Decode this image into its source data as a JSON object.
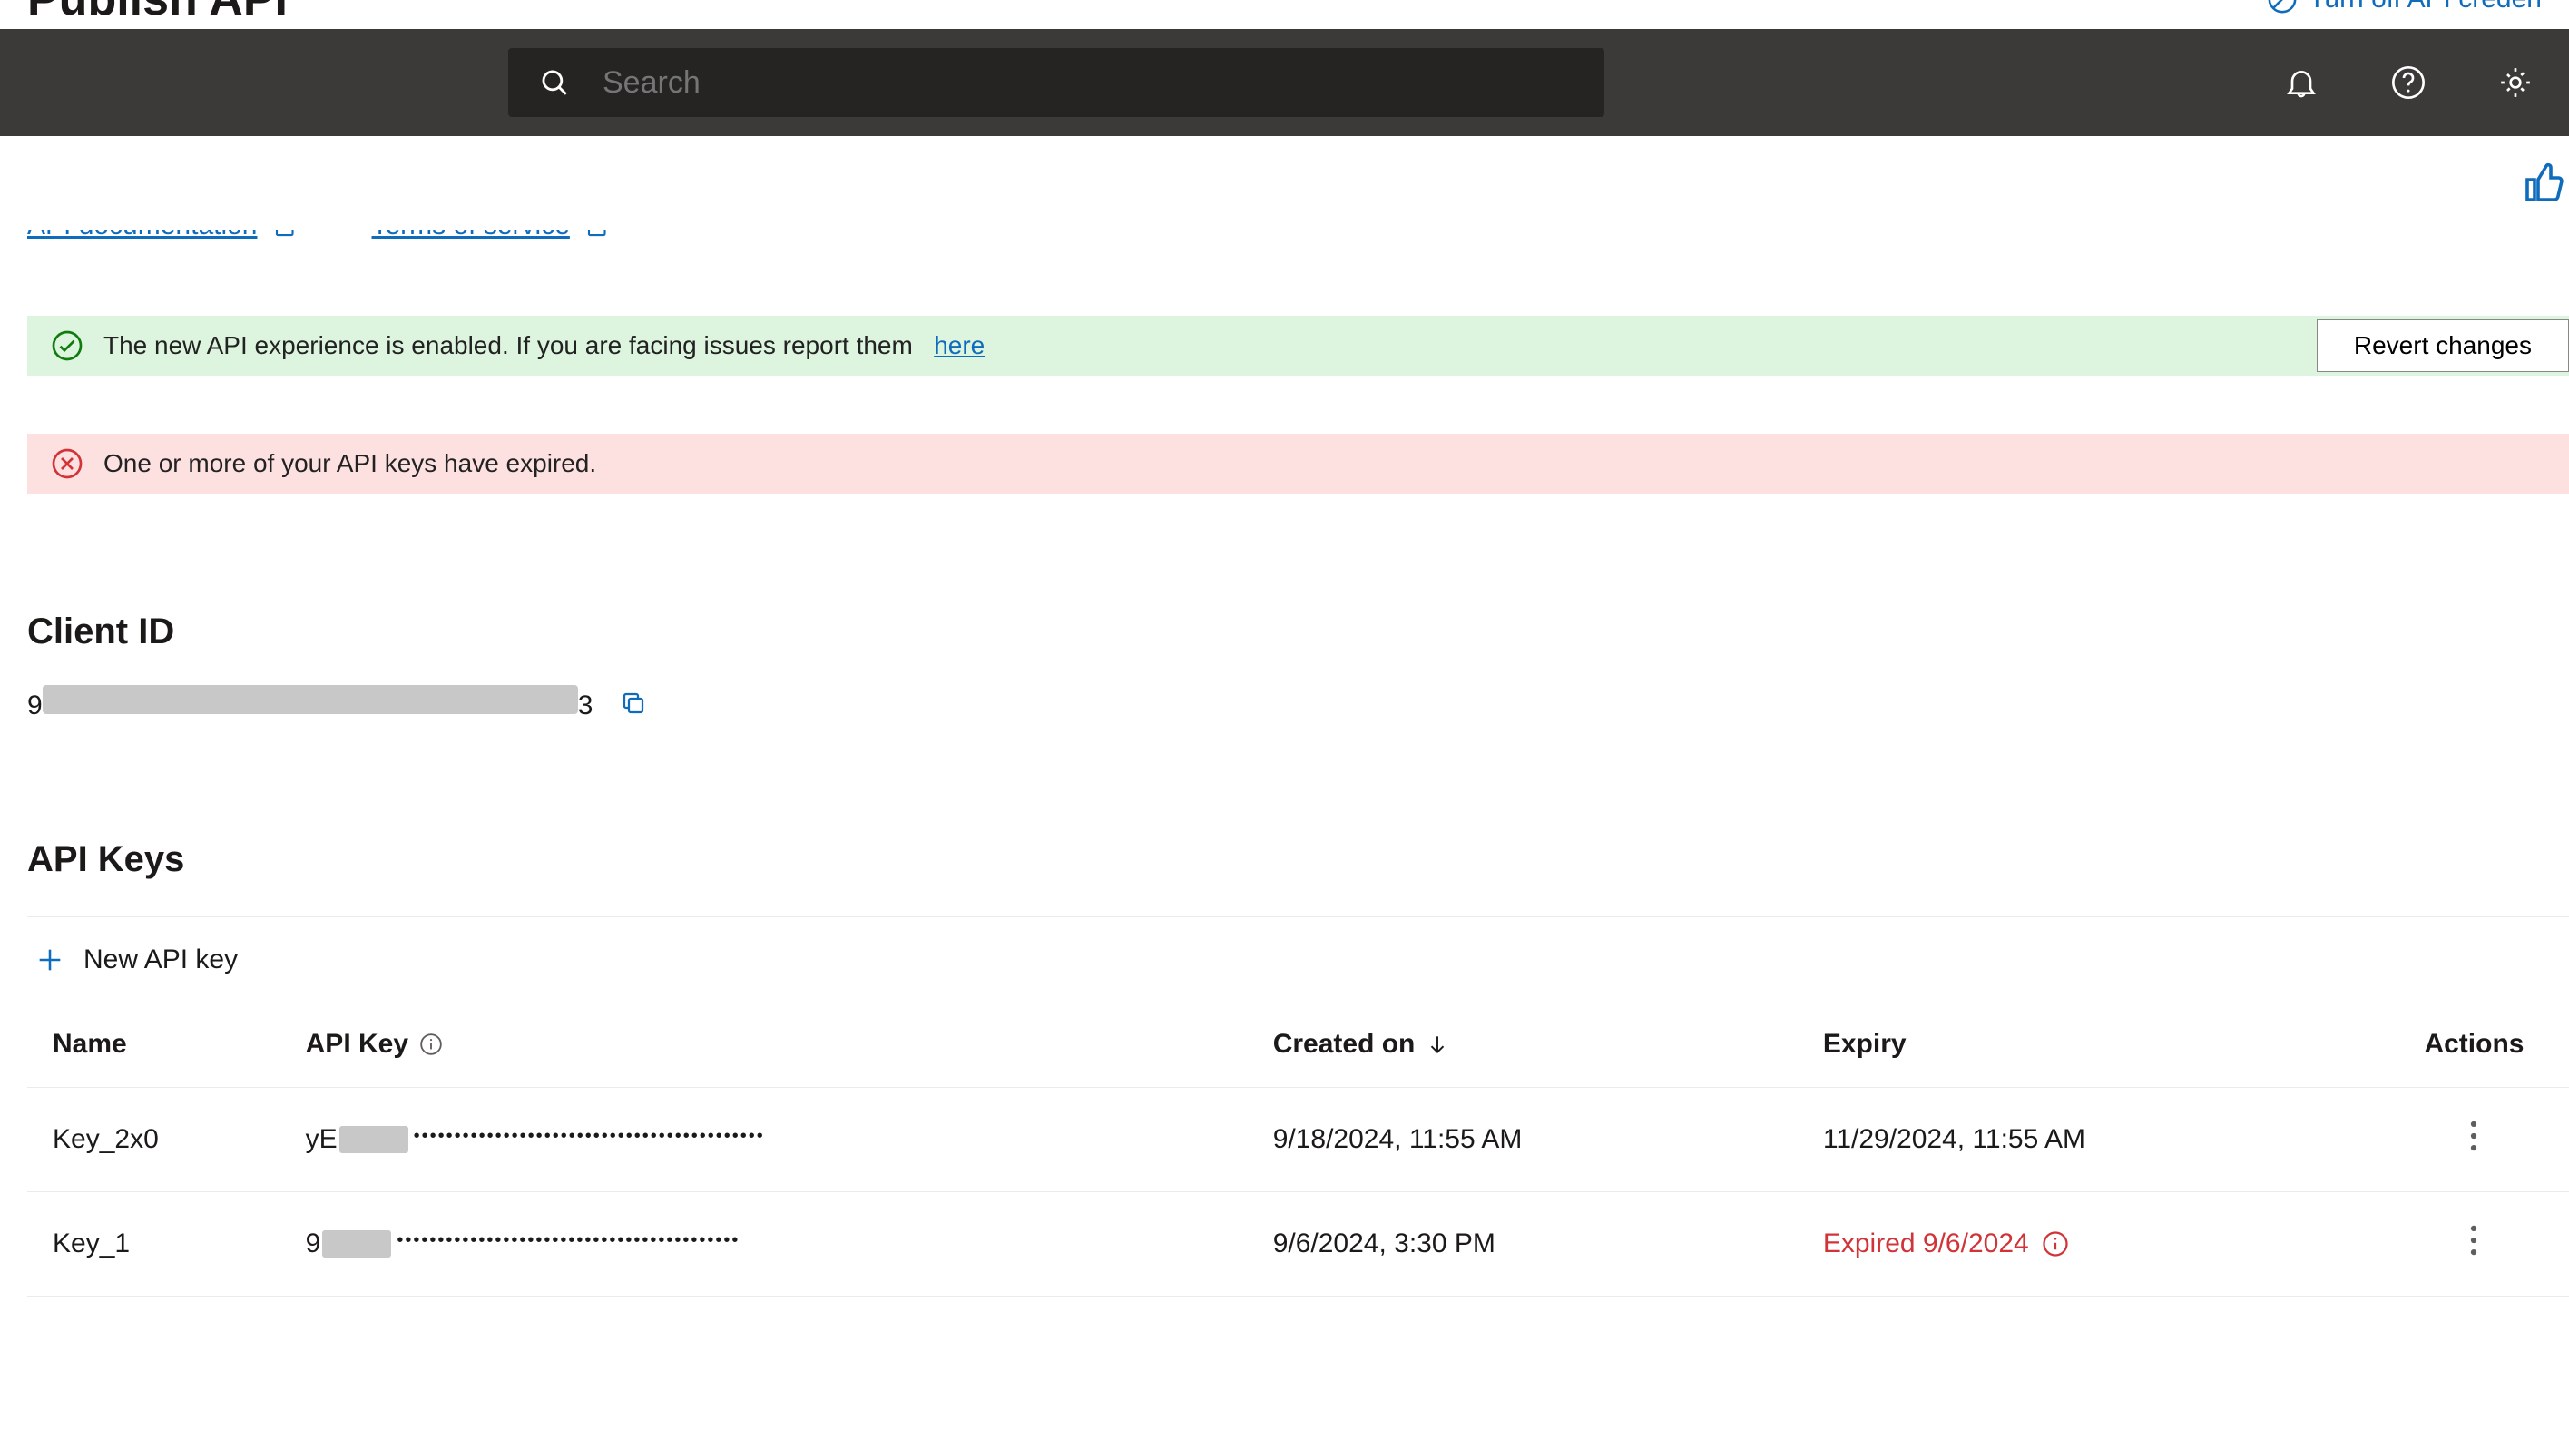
{
  "peek": {
    "title": "Publish API",
    "right_label": "Turn off API creden"
  },
  "cmdbar": {
    "search_placeholder": "Search"
  },
  "links": {
    "api_docs": "API documentation",
    "tos": "Terms of service"
  },
  "banners": {
    "success_text": "The new API experience is enabled. If you are facing issues report them",
    "success_link": "here",
    "revert_label": "Revert changes",
    "error_text": "One or more of your API keys have expired."
  },
  "client_id": {
    "heading": "Client ID",
    "prefix": "9",
    "suffix": "3"
  },
  "api_keys": {
    "heading": "API Keys",
    "new_label": "New API key",
    "columns": {
      "name": "Name",
      "api_key": "API Key",
      "created": "Created on",
      "expiry": "Expiry",
      "actions": "Actions"
    },
    "rows": [
      {
        "name": "Key_2x0",
        "key_prefix": "yE",
        "key_dots": "•••••••••••••••••••••••••••••••••••••••••••",
        "created": "9/18/2024, 11:55 AM",
        "expiry": "11/29/2024, 11:55 AM",
        "expired": false
      },
      {
        "name": "Key_1",
        "key_prefix": "9",
        "key_dots": "••••••••••••••••••••••••••••••••••••••••••",
        "created": "9/6/2024, 3:30 PM",
        "expiry": "Expired 9/6/2024",
        "expired": true
      }
    ]
  }
}
